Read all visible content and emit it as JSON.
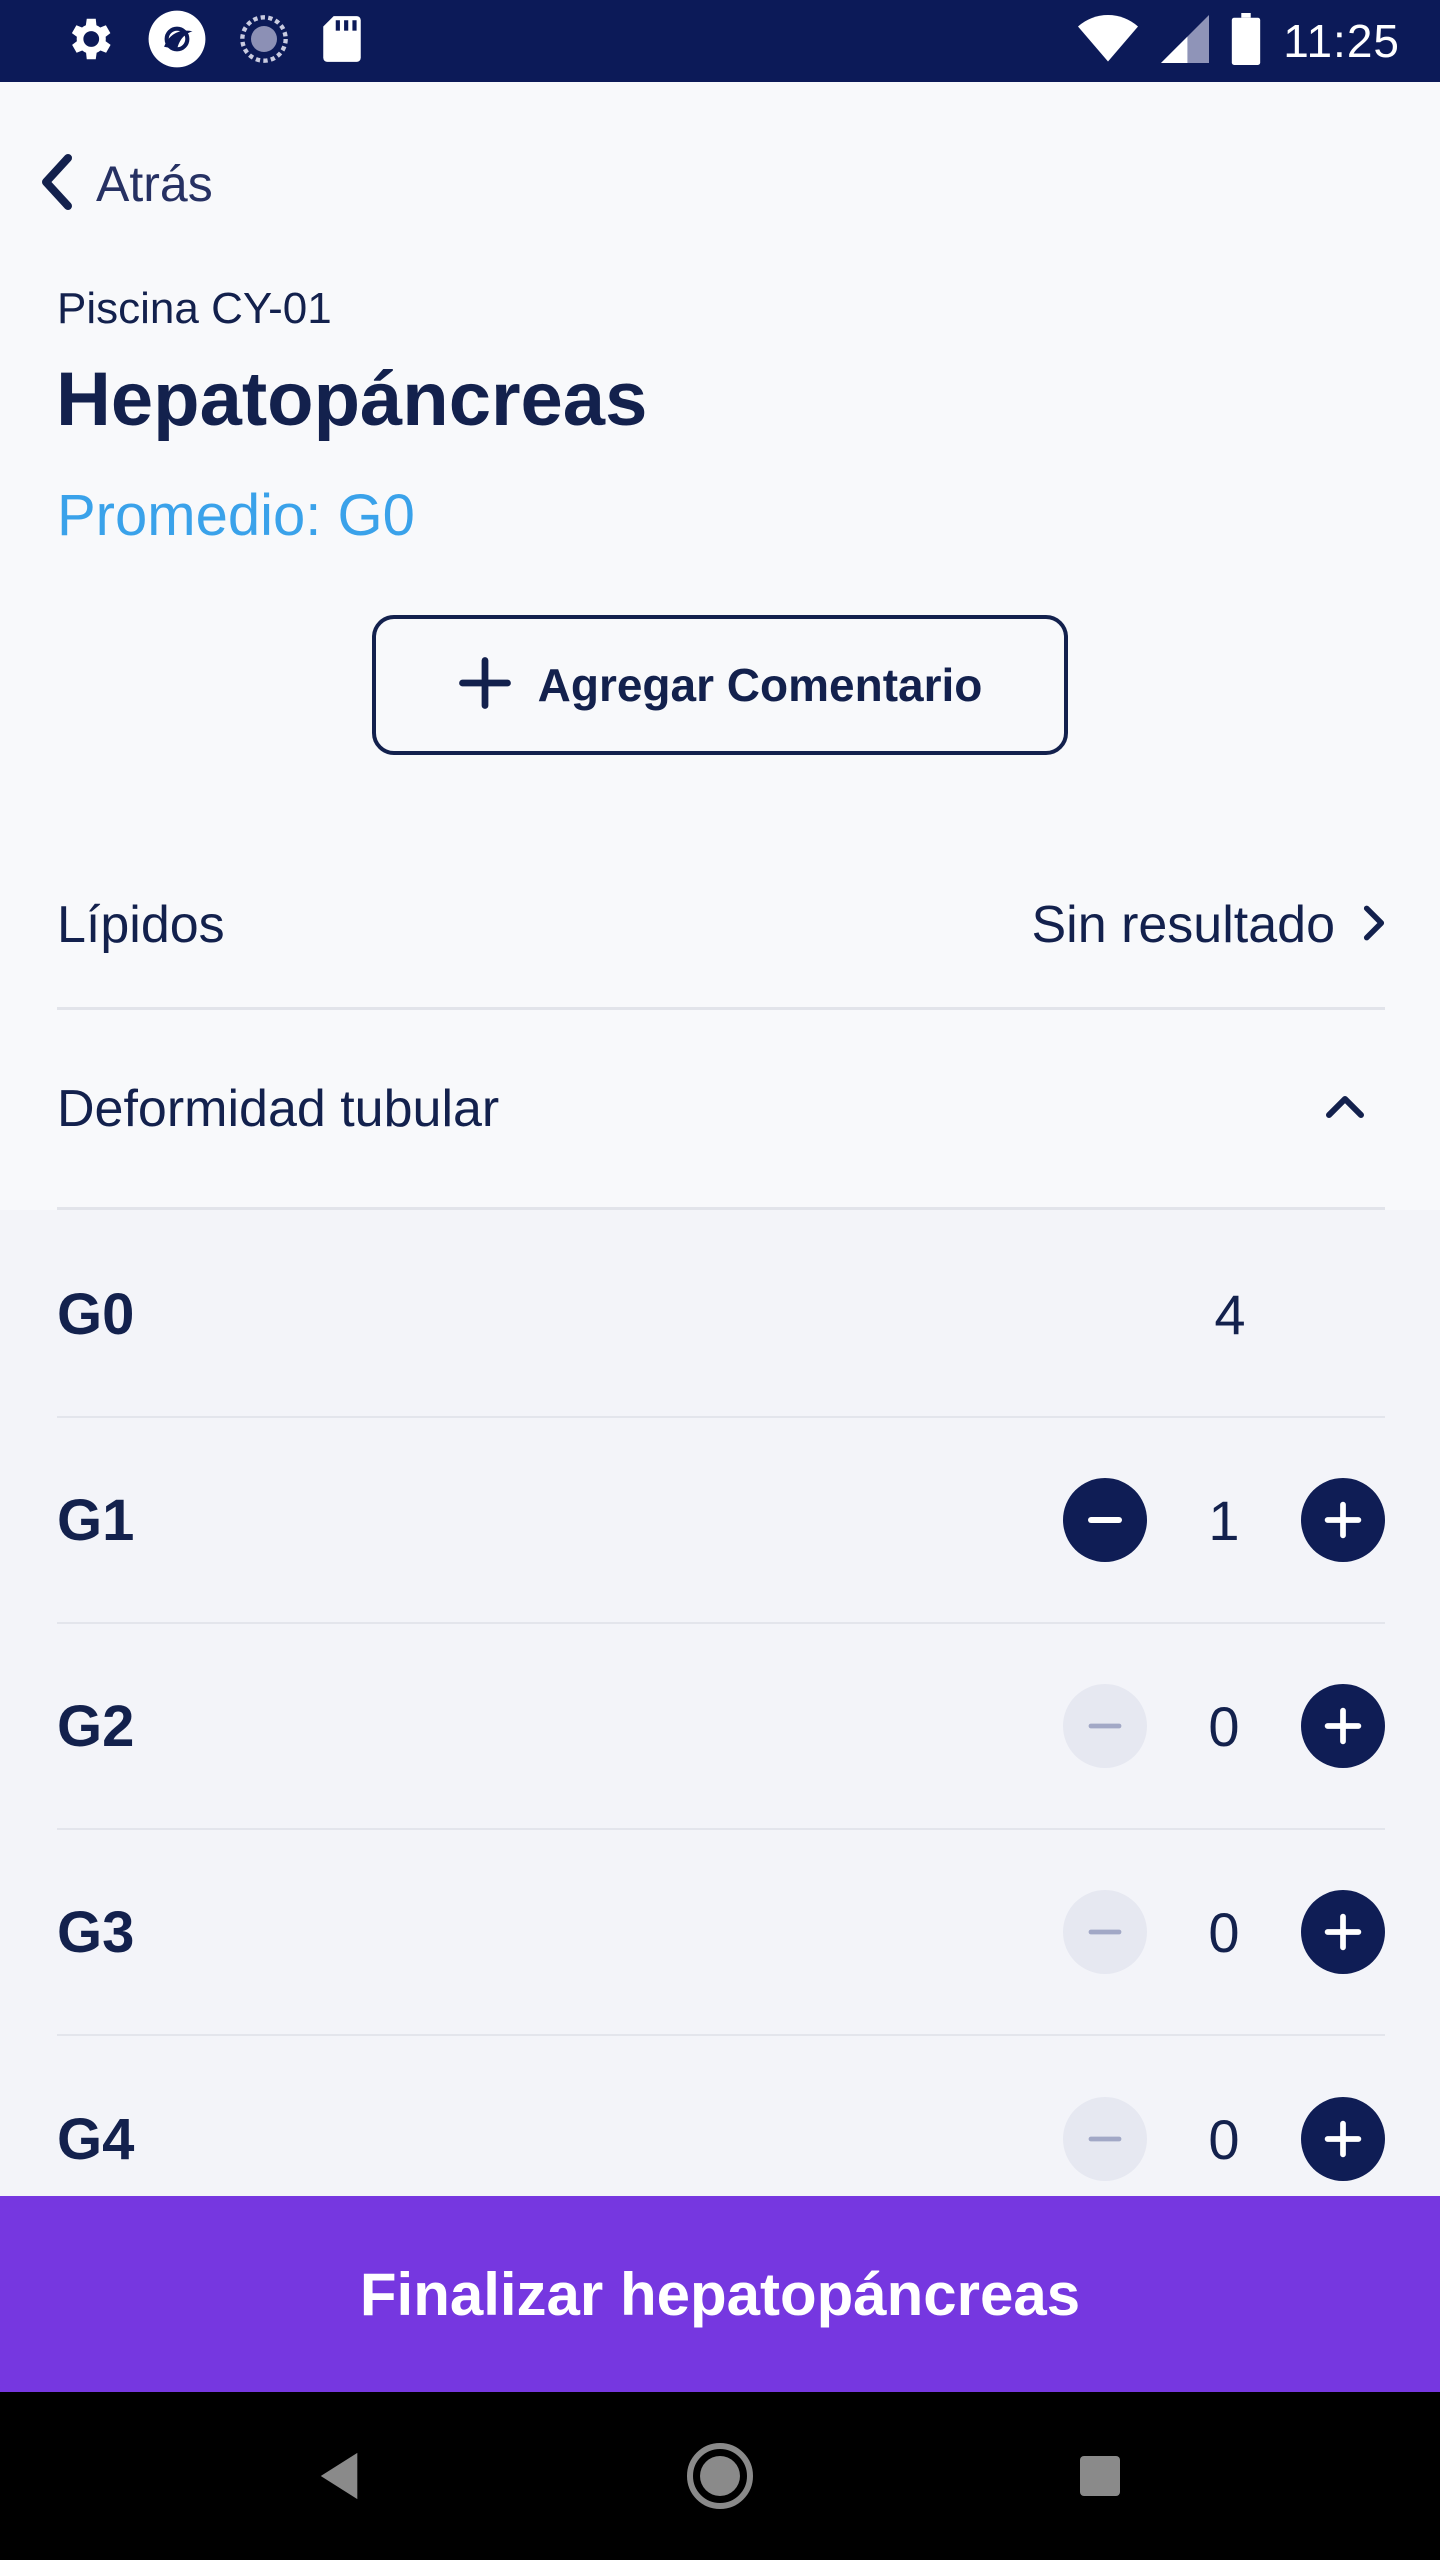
{
  "status_bar": {
    "time": "11:25",
    "left_icons": [
      "settings-icon",
      "app-logo-icon",
      "sync-icon",
      "sd-card-icon"
    ],
    "right_icons": [
      "wifi-icon",
      "signal-icon",
      "battery-icon"
    ]
  },
  "header": {
    "back_label": "Atrás",
    "subtitle": "Piscina CY-01",
    "title": "Hepatopáncreas",
    "average": "Promedio: G0"
  },
  "add_comment": {
    "label": "Agregar Comentario"
  },
  "sections": [
    {
      "label": "Lípidos",
      "value": "Sin resultado",
      "state": "collapsed"
    },
    {
      "label": "Deformidad tubular",
      "state": "expanded"
    }
  ],
  "grades": [
    {
      "label": "G0",
      "count": "4"
    },
    {
      "label": "G1",
      "count": "1"
    },
    {
      "label": "G2",
      "count": "0"
    },
    {
      "label": "G3",
      "count": "0"
    },
    {
      "label": "G4",
      "count": "0"
    }
  ],
  "finish_button": {
    "label": "Finalizar hepatopáncreas"
  },
  "colors": {
    "primary": "#13214d",
    "accent_blue": "#3aa2ea",
    "purple": "#7637e0",
    "status_bar": "#0c1a58"
  }
}
